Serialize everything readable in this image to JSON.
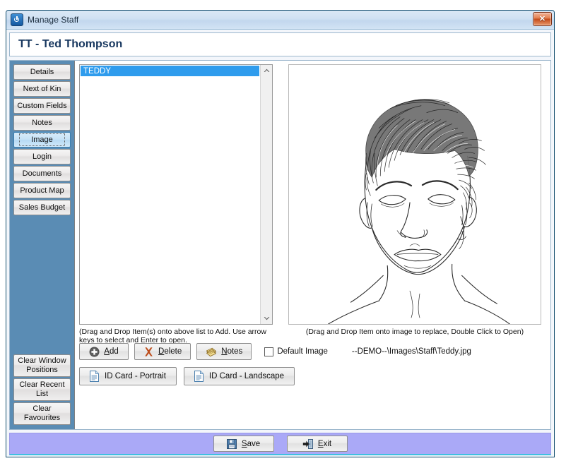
{
  "window": {
    "title": "Manage Staff",
    "icon": "power-icon",
    "close_label": "✕"
  },
  "header": {
    "title": "TT - Ted Thompson"
  },
  "sidebar": {
    "tabs": [
      {
        "label": "Details",
        "selected": false
      },
      {
        "label": "Next of Kin",
        "selected": false
      },
      {
        "label": "Custom Fields",
        "selected": false
      },
      {
        "label": "Notes",
        "selected": false
      },
      {
        "label": "Image",
        "selected": true
      },
      {
        "label": "Login",
        "selected": false
      },
      {
        "label": "Documents",
        "selected": false
      },
      {
        "label": "Product Map",
        "selected": false
      },
      {
        "label": "Sales Budget",
        "selected": false
      }
    ],
    "bottom_buttons": [
      {
        "label": "Clear Window Positions"
      },
      {
        "label": "Clear Recent List"
      },
      {
        "label": "Clear Favourites"
      }
    ]
  },
  "list": {
    "items": [
      {
        "label": "TEDDY",
        "selected": true
      }
    ],
    "hint": "(Drag and Drop Item(s) onto above list to Add. Use arrow keys to select and Enter to open."
  },
  "toolbar": {
    "add_label": "Add",
    "delete_label": "Delete",
    "notes_label": "Notes",
    "default_image_label": "Default Image",
    "default_image_checked": false,
    "file_path": "--DEMO--\\Images\\Staff\\Teddy.jpg",
    "id_card_portrait_label": "ID Card - Portrait",
    "id_card_landscape_label": "ID Card - Landscape"
  },
  "image_panel": {
    "hint": "(Drag and Drop Item onto image to replace, Double Click to Open)",
    "alt": "pencil sketch portrait of a young man"
  },
  "footer": {
    "save_label": "Save",
    "exit_label": "Exit"
  },
  "colors": {
    "sidebar": "#5a8cb4",
    "footer": "#aaa9f7",
    "selection": "#2f9ced",
    "header_text": "#16365e",
    "window_border": "#0e4a6b"
  }
}
